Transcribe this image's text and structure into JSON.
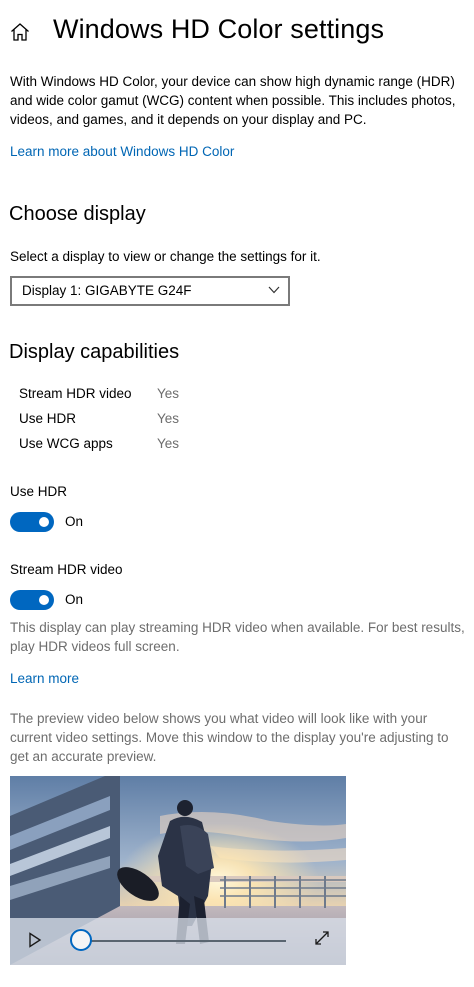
{
  "header": {
    "title": "Windows HD Color settings",
    "home_icon": "home-icon"
  },
  "intro": {
    "text": "With Windows HD Color, your device can show high dynamic range (HDR) and wide color gamut (WCG) content when possible. This includes photos, videos, and games, and it depends on your display and PC.",
    "link": "Learn more about Windows HD Color"
  },
  "choose_display": {
    "heading": "Choose display",
    "label": "Select a display to view or change the settings for it.",
    "selected": "Display 1: GIGABYTE G24F"
  },
  "capabilities": {
    "heading": "Display capabilities",
    "rows": [
      {
        "name": "Stream HDR video",
        "value": "Yes"
      },
      {
        "name": "Use HDR",
        "value": "Yes"
      },
      {
        "name": "Use WCG apps",
        "value": "Yes"
      }
    ]
  },
  "use_hdr": {
    "label": "Use HDR",
    "state": "On",
    "on": true
  },
  "stream_hdr": {
    "label": "Stream HDR video",
    "state": "On",
    "on": true,
    "description": "This display can play streaming HDR video when available. For best results, play HDR videos full screen.",
    "link": "Learn more"
  },
  "preview": {
    "description": "The preview video below shows you what video will look like with your current video settings. Move this window to the display you're adjusting to get an accurate preview.",
    "progress": 0
  },
  "colors": {
    "accent": "#0067c0",
    "link": "#0066b4",
    "secondary_text": "#6d6d6d"
  }
}
